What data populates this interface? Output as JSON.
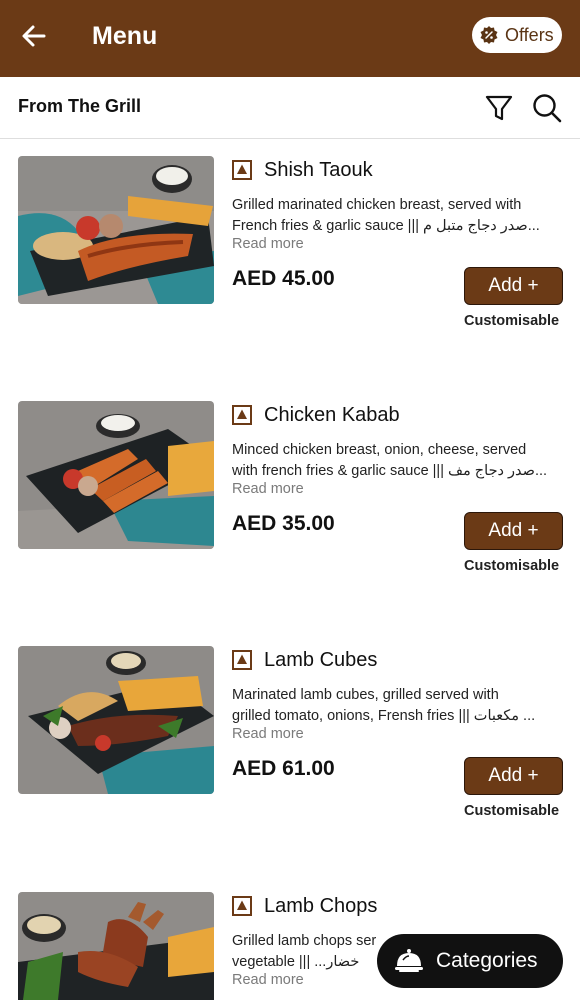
{
  "header": {
    "title": "Menu",
    "back_icon": "arrow-left-icon",
    "offers_label": "Offers",
    "offers_icon": "discount-badge-icon",
    "background_color": "#6b3a16"
  },
  "section": {
    "title": "From The Grill",
    "filter_icon": "filter-icon",
    "search_icon": "search-icon"
  },
  "items": [
    {
      "name": "Shish Taouk",
      "description_line1": "Grilled marinated chicken breast, served with",
      "description_line2": "French fries & garlic sauce ||| صدر دجاج متبل م...",
      "read_more": "Read more",
      "price": "AED 45.00",
      "add_label": "Add +",
      "customisable_label": "Customisable"
    },
    {
      "name": "Chicken Kabab",
      "description_line1": "Minced chicken breast, onion, cheese, served",
      "description_line2": "with french fries & garlic sauce ||| صدر دجاج مف...",
      "read_more": "Read more",
      "price": "AED 35.00",
      "add_label": "Add +",
      "customisable_label": "Customisable"
    },
    {
      "name": "Lamb Cubes",
      "description_line1": "Marinated lamb cubes, grilled served with",
      "description_line2": "grilled tomato, onions, Frensh fries ||| مكعبات ...",
      "read_more": "Read more",
      "price": "AED 61.00",
      "add_label": "Add +",
      "customisable_label": "Customisable"
    },
    {
      "name": "Lamb Chops",
      "description_line1": "Grilled lamb chops ser",
      "description_line2": "vegetable ||| ...خضار",
      "read_more": "Read more"
    }
  ],
  "categories_button": {
    "label": "Categories",
    "icon": "food-cloche-icon"
  },
  "colors": {
    "brand_brown": "#6b3a16",
    "button_border": "#2c170a",
    "categories_bg": "#111111"
  }
}
